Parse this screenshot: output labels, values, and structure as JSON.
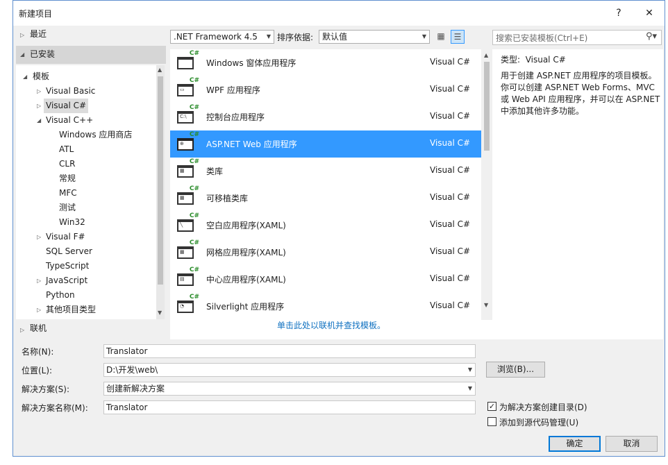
{
  "window": {
    "title": "新建项目",
    "help": "?",
    "close": "✕"
  },
  "left": {
    "recent": "最近",
    "installed": "已安装",
    "templates": "模板",
    "tree": [
      "Visual Basic",
      "Visual C#",
      "Visual C++",
      "Windows 应用商店",
      "ATL",
      "CLR",
      "常规",
      "MFC",
      "测试",
      "Win32",
      "Visual F#",
      "SQL Server",
      "TypeScript",
      "JavaScript",
      "Python",
      "其他项目类型"
    ],
    "online": "联机"
  },
  "toolbar": {
    "framework": ".NET Framework 4.5",
    "sort_label": "排序依据:",
    "sort_value": "默认值",
    "search_placeholder": "搜索已安装模板(Ctrl+E)"
  },
  "templates": [
    {
      "name": "Windows 窗体应用程序",
      "lang": "Visual C#"
    },
    {
      "name": "WPF 应用程序",
      "lang": "Visual C#"
    },
    {
      "name": "控制台应用程序",
      "lang": "Visual C#"
    },
    {
      "name": "ASP.NET Web 应用程序",
      "lang": "Visual C#"
    },
    {
      "name": "类库",
      "lang": "Visual C#"
    },
    {
      "name": "可移植类库",
      "lang": "Visual C#"
    },
    {
      "name": "空白应用程序(XAML)",
      "lang": "Visual C#"
    },
    {
      "name": "网格应用程序(XAML)",
      "lang": "Visual C#"
    },
    {
      "name": "中心应用程序(XAML)",
      "lang": "Visual C#"
    },
    {
      "name": "Silverlight 应用程序",
      "lang": "Visual C#"
    }
  ],
  "online_link": "单击此处以联机并查找模板。",
  "info": {
    "type_label": "类型:",
    "type_value": "Visual C#",
    "description": "用于创建 ASP.NET 应用程序的项目模板。你可以创建 ASP.NET Web Forms、MVC 或 Web API 应用程序，并可以在 ASP.NET 中添加其他许多功能。"
  },
  "form": {
    "name_label": "名称(N):",
    "name_value": "Translator",
    "location_label": "位置(L):",
    "location_value": "D:\\开发\\web\\",
    "browse": "浏览(B)...",
    "solution_label": "解决方案(S):",
    "solution_value": "创建新解决方案",
    "solution_name_label": "解决方案名称(M):",
    "solution_name_value": "Translator",
    "create_dir_label": "为解决方案创建目录(D)",
    "create_dir_checked": true,
    "source_control_label": "添加到源代码管理(U)",
    "source_control_checked": false,
    "ok": "确定",
    "cancel": "取消"
  },
  "selected_template_index": 3,
  "colors": {
    "selection": "#3399ff",
    "link": "#0e70c0",
    "accent_border": "#0078d7"
  }
}
